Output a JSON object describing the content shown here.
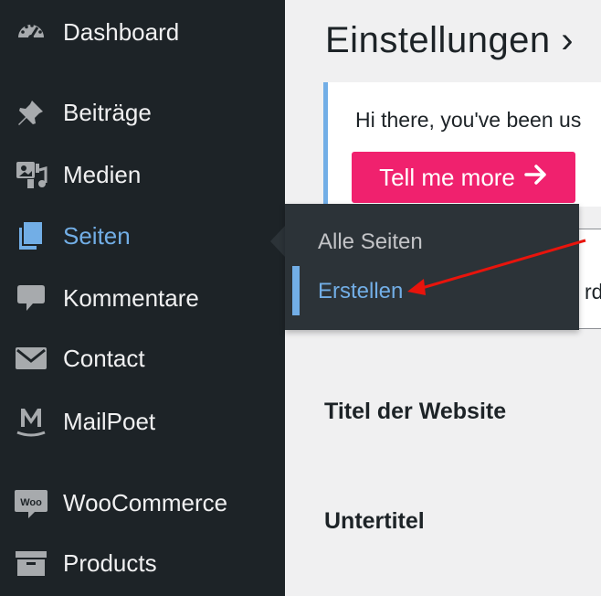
{
  "sidebar": {
    "items": [
      {
        "label": "Dashboard",
        "icon": "dashboard-icon"
      },
      {
        "label": "Beiträge",
        "icon": "pin-icon"
      },
      {
        "label": "Medien",
        "icon": "media-icon"
      },
      {
        "label": "Seiten",
        "icon": "pages-icon",
        "active": true
      },
      {
        "label": "Kommentare",
        "icon": "comment-icon"
      },
      {
        "label": "Contact",
        "icon": "mail-icon"
      },
      {
        "label": "MailPoet",
        "icon": "mailpoet-icon"
      },
      {
        "label": "WooCommerce",
        "icon": "woo-icon"
      },
      {
        "label": "Products",
        "icon": "archive-icon"
      }
    ],
    "woo_badge": "Woo"
  },
  "flyout": {
    "items": [
      {
        "label": "Alle Seiten"
      },
      {
        "label": "Erstellen",
        "current": true
      }
    ]
  },
  "main": {
    "title": "Einstellungen ›",
    "notice_text": "Hi there, you've been us",
    "notice_button": "Tell me more",
    "input_fragment": "rd",
    "site_title_label": "Titel der Website",
    "tagline_label": "Untertitel"
  },
  "colors": {
    "sidebar_bg": "#1d2327",
    "flyout_bg": "#2c3338",
    "accent": "#72aee6",
    "notice_button": "#f0216e",
    "annotation_arrow": "#e8140c"
  }
}
